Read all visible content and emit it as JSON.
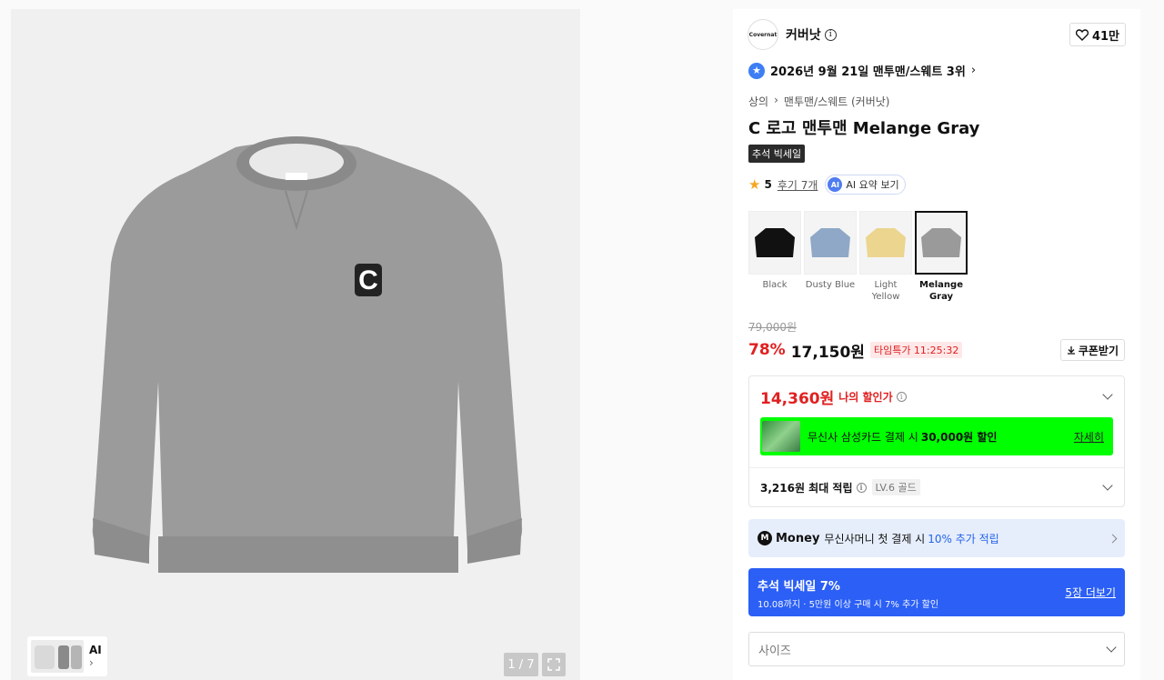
{
  "gallery": {
    "ai_label": "AI",
    "ai_arrow": "›",
    "counter": "1 / 7",
    "expand_icon": "expand-icon"
  },
  "brand": {
    "logo_text": "Covernat",
    "name": "커버낫",
    "likes": "41만"
  },
  "ranking": {
    "text": "2026년 9월 21일 맨투맨/스웨트 3위",
    "chevron": "›"
  },
  "breadcrumb": {
    "level1": "상의",
    "separator": "›",
    "level2": "맨투맨/스웨트 (커버낫)"
  },
  "product": {
    "title": "C 로고 맨투맨 Melange Gray",
    "tag": "추석 빅세일",
    "rating": "5",
    "reviews_link": "후기 7개",
    "ai_summary": "AI 요약 보기"
  },
  "colors": [
    {
      "label": "Black",
      "swatch": "#111111",
      "selected": false
    },
    {
      "label": "Dusty Blue",
      "swatch": "#8fa8c7",
      "selected": false
    },
    {
      "label": "Light Yellow",
      "swatch": "#ecd58f",
      "selected": false
    },
    {
      "label": "Melange Gray",
      "swatch": "#9a9a9a",
      "selected": true
    }
  ],
  "pricing": {
    "original": "79,000원",
    "discount_pct": "78%",
    "price": "17,150원",
    "timer": "타임특가 11:25:32",
    "coupon_button": "쿠폰받기"
  },
  "discount_box": {
    "my_price": "14,360원",
    "my_price_label": "나의 할인가",
    "card_text": "무신사 삼성카드 결제 시",
    "card_amount": "30,000원 할인",
    "card_detail": "자세히",
    "points": "3,216원 최대 적립",
    "level": "LV.6 골드"
  },
  "money_bar": {
    "brand": "Money",
    "text": "무신사머니 첫 결제 시",
    "accent": "10% 추가 적립"
  },
  "event_bar": {
    "title": "추석 빅세일 7%",
    "subtitle": "10.08까지 · 5만원 이상 구매 시 7% 추가 할인",
    "more": "5장 더보기"
  },
  "size_select": {
    "placeholder": "사이즈"
  },
  "theme": {
    "accent_red": "#e02020",
    "accent_blue": "#2b5ff5",
    "card_green": "#00ff00"
  }
}
